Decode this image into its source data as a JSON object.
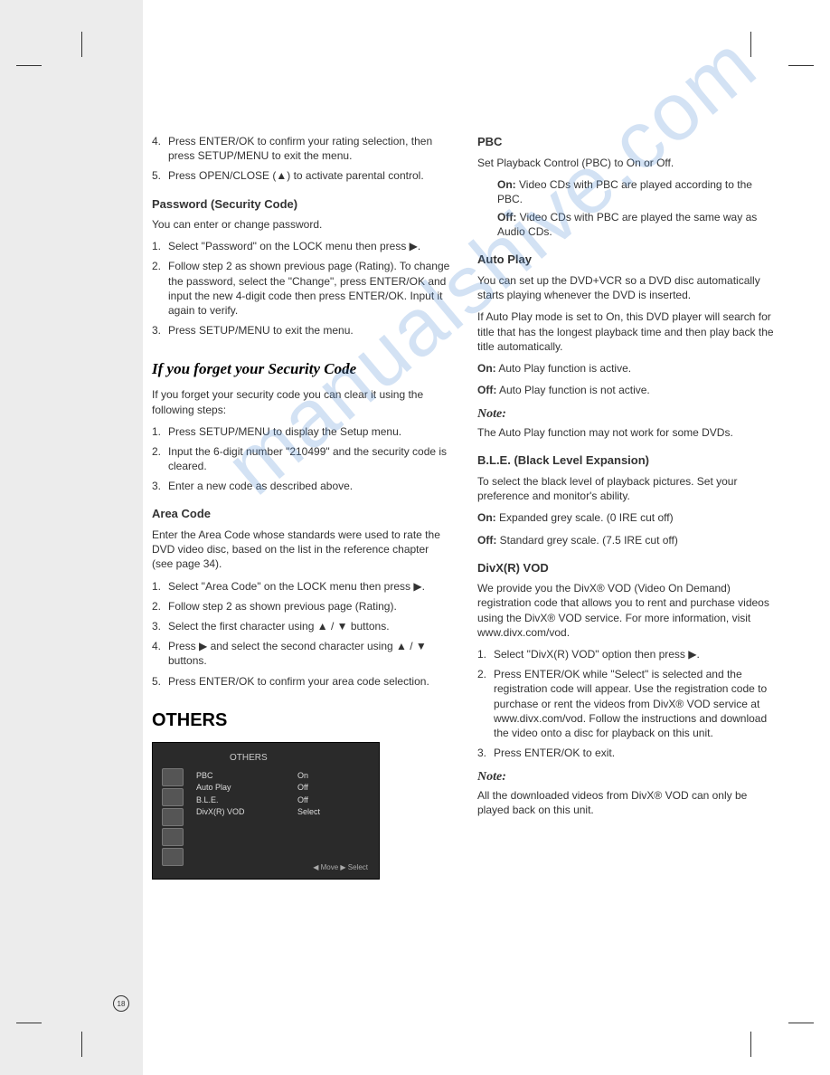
{
  "page_number": "18",
  "watermark": "manualshive.com",
  "left_column": {
    "intro_steps": [
      "Press ENTER/OK to confirm your rating selection, then press SETUP/MENU to exit the menu.",
      "Press OPEN/CLOSE (▲) to activate parental control."
    ],
    "intro_start": 4,
    "password_heading": "Password (Security Code)",
    "password_intro": "You can enter or change password.",
    "password_steps": [
      "Select \"Password\" on the LOCK menu then press ▶.",
      "Follow step 2 as shown previous page (Rating). To change the password, select the \"Change\", press ENTER/OK and input the new 4-digit code then press ENTER/OK. Input it again to verify.",
      "Press SETUP/MENU to exit the menu."
    ],
    "forget_heading": "If you forget your Security Code",
    "forget_intro": "If you forget your security code you can clear it using the following steps:",
    "forget_steps": [
      "Press SETUP/MENU to display the Setup menu.",
      "Input the 6-digit number \"210499\" and the security code is cleared.",
      "Enter a new code as described above."
    ],
    "area_heading": "Area Code",
    "area_intro": "Enter the Area Code whose standards were used to rate the DVD video disc, based on the list in the reference chapter (see page 34).",
    "area_steps": [
      "Select \"Area Code\" on the LOCK menu then press ▶.",
      "Follow step 2 as shown previous page (Rating).",
      "Select the first character using ▲ / ▼ buttons.",
      "Press ▶ and select the second character using ▲ / ▼ buttons.",
      "Press ENTER/OK to confirm your area code selection."
    ],
    "others_heading": "OTHERS",
    "menu": {
      "title": "OTHERS",
      "items": [
        "PBC",
        "Auto Play",
        "B.L.E.",
        "DivX(R) VOD"
      ],
      "values": [
        "On",
        "Off",
        "Off",
        "Select"
      ],
      "footer": "◀ Move ▶ Select"
    }
  },
  "right_column": {
    "pbc_heading": "PBC",
    "pbc_intro": "Set Playback Control (PBC) to On or Off.",
    "pbc_on_label": "On:",
    "pbc_on": "Video CDs with PBC are played according to the PBC.",
    "pbc_off_label": "Off:",
    "pbc_off": "Video CDs with PBC are played the same way as Audio CDs.",
    "autoplay_heading": "Auto Play",
    "autoplay_p1": "You can set up the DVD+VCR so a DVD disc automatically starts playing whenever the DVD is inserted.",
    "autoplay_p2": "If Auto Play mode is set to On, this DVD player will search for title that has the longest playback time and then play back the title automatically.",
    "autoplay_on_label": "On:",
    "autoplay_on": "Auto Play function is active.",
    "autoplay_off_label": "Off:",
    "autoplay_off": "Auto Play function is not active.",
    "note1_heading": "Note:",
    "note1": "The Auto Play function may not work for some DVDs.",
    "ble_heading": "B.L.E. (Black Level Expansion)",
    "ble_p": "To select the black level of playback pictures. Set your preference and monitor's ability.",
    "ble_on_label": "On:",
    "ble_on": "Expanded grey scale. (0 IRE cut off)",
    "ble_off_label": "Off:",
    "ble_off": "Standard grey scale. (7.5 IRE cut off)",
    "divx_heading": "DivX(R) VOD",
    "divx_p": "We provide you the DivX® VOD (Video On Demand) registration code that allows you to rent and purchase videos using the DivX® VOD service. For more information, visit www.divx.com/vod.",
    "divx_steps": [
      "Select \"DivX(R) VOD\" option then press ▶.",
      "Press ENTER/OK while \"Select\" is selected and the registration code will appear. Use the registration code to purchase or rent the videos from DivX® VOD service at www.divx.com/vod. Follow the instructions and download the video onto a disc for playback on this unit.",
      "Press ENTER/OK to exit."
    ],
    "note2_heading": "Note:",
    "note2": "All the downloaded videos from DivX® VOD can only be played back on this unit."
  }
}
